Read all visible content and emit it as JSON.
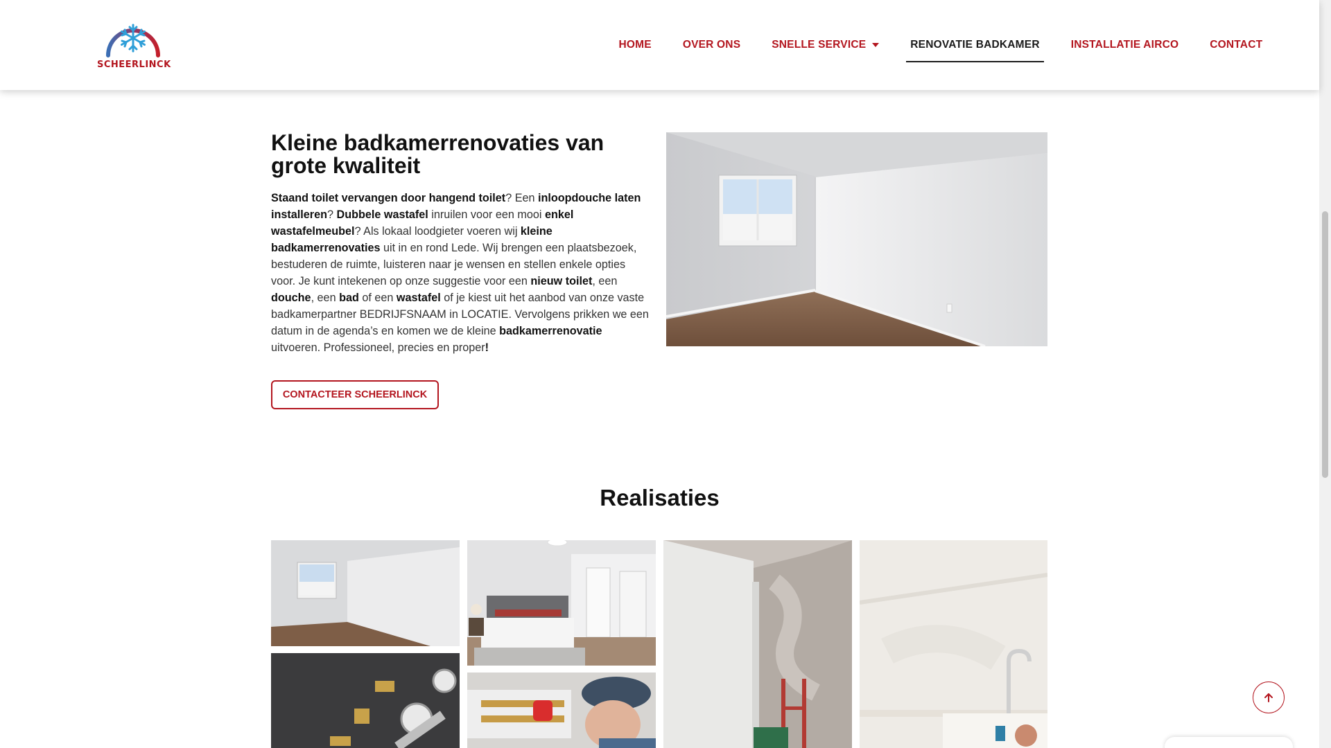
{
  "brand": {
    "name": "SCHEERLINCK",
    "accent_color": "#b3151e"
  },
  "nav": {
    "items": [
      {
        "label": "HOME"
      },
      {
        "label": "OVER ONS"
      },
      {
        "label": "SNELLE SERVICE"
      },
      {
        "label": "RENOVATIE BADKAMER"
      },
      {
        "label": "INSTALLATIE AIRCO"
      },
      {
        "label": "CONTACT"
      }
    ],
    "active": "RENOVATIE BADKAMER"
  },
  "intro": {
    "title": "Kleine badkamerrenovaties van grote kwaliteit",
    "paragraph": [
      {
        "b": true,
        "t": "Staand toilet vervangen door hangend toilet"
      },
      {
        "b": false,
        "t": "? Een "
      },
      {
        "b": true,
        "t": "inloopdouche laten installeren"
      },
      {
        "b": false,
        "t": "? "
      },
      {
        "b": true,
        "t": "Dubbele wastafel"
      },
      {
        "b": false,
        "t": " inruilen voor een mooi "
      },
      {
        "b": true,
        "t": "enkel wastafelmeubel"
      },
      {
        "b": false,
        "t": "? Als lokaal loodgieter voeren wij "
      },
      {
        "b": true,
        "t": "kleine badkamerrenovaties"
      },
      {
        "b": false,
        "t": " uit in en rond Lede. Wij brengen een plaatsbezoek, bestuderen de ruimte, luisteren naar je wensen en stellen enkele opties voor. Je kunt intekenen op onze suggestie voor een "
      },
      {
        "b": true,
        "t": "nieuw toilet"
      },
      {
        "b": false,
        "t": ", een "
      },
      {
        "b": true,
        "t": "douche"
      },
      {
        "b": false,
        "t": ", een "
      },
      {
        "b": true,
        "t": "bad"
      },
      {
        "b": false,
        "t": " of een "
      },
      {
        "b": true,
        "t": "wastafel"
      },
      {
        "b": false,
        "t": " of je kiest uit het aanbod van onze vaste badkamerpartner BEDRIJFSNAAM in LOCATIE. Vervolgens prikken we een datum in de agenda’s en komen we de kleine "
      },
      {
        "b": true,
        "t": "badkamerrenovatie"
      },
      {
        "b": false,
        "t": " uitvoeren. Professioneel, precies en proper"
      },
      {
        "b": true,
        "t": "!"
      }
    ],
    "button_label": "CONTACTEER SCHEERLINCK"
  },
  "gallery": {
    "title": "Realisaties"
  },
  "icons": {
    "logo": "snowflake-logo-icon",
    "dropdown": "caret-down-icon",
    "scroll_top": "arrow-up-icon"
  }
}
